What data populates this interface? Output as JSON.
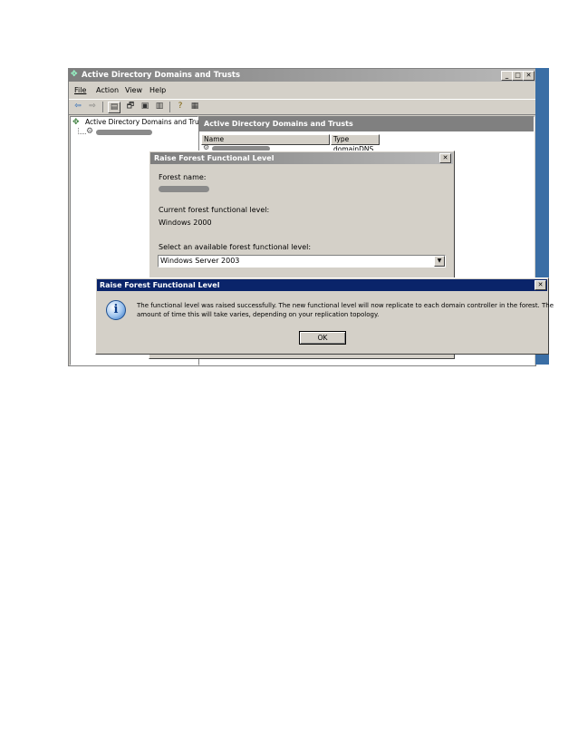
{
  "main_window": {
    "title": "Active Directory Domains and Trusts",
    "menu": [
      "File",
      "Action",
      "View",
      "Help"
    ],
    "tree_root": "Active Directory Domains and Trusts",
    "right_header": "Active Directory Domains and Trusts",
    "columns": [
      "Name",
      "Type"
    ],
    "rows": [
      {
        "type": "domainDNS"
      }
    ]
  },
  "raise_dialog": {
    "title": "Raise Forest Functional Level",
    "forest_name_label": "Forest name:",
    "current_level_label": "Current forest functional level:",
    "current_level_value": "Windows 2000",
    "select_label": "Select an available forest functional level:",
    "select_value": "Windows Server 2003"
  },
  "message_box": {
    "title": "Raise Forest Functional Level",
    "message_line1": "The functional level was raised successfully. The new functional level will now replicate to each domain controller in the forest. The",
    "message_line2": "amount of time this will take varies, depending on your replication topology.",
    "ok_label": "OK"
  }
}
